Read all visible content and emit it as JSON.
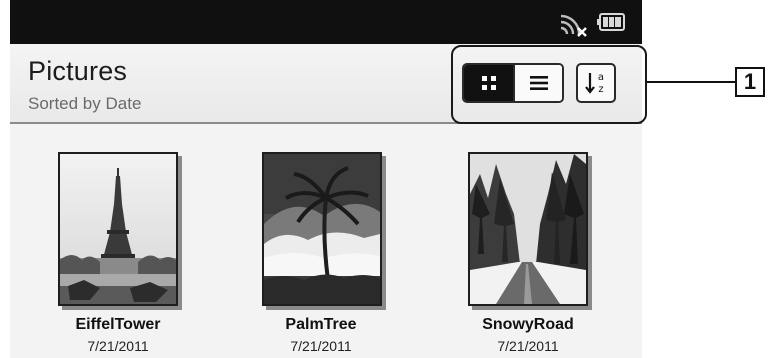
{
  "statusbar": {
    "wifi_icon": "wifi-disconnected-icon",
    "battery_icon": "battery-icon"
  },
  "header": {
    "title": "Pictures",
    "subtitle": "Sorted by Date"
  },
  "toolbar": {
    "view_thumbnail_icon": "thumbnail-view-icon",
    "view_list_icon": "list-view-icon",
    "sort_icon": "sort-az-icon",
    "active_view": "thumbnail"
  },
  "callout": {
    "label": "1"
  },
  "pictures": [
    {
      "name": "EiffelTower",
      "date": "7/21/2011"
    },
    {
      "name": "PalmTree",
      "date": "7/21/2011"
    },
    {
      "name": "SnowyRoad",
      "date": "7/21/2011"
    }
  ],
  "colors": {
    "statusbar_bg": "#101010",
    "header_bg": "#eeeeee",
    "active_toggle": "#111111",
    "content_bg": "#f3f3f3"
  }
}
